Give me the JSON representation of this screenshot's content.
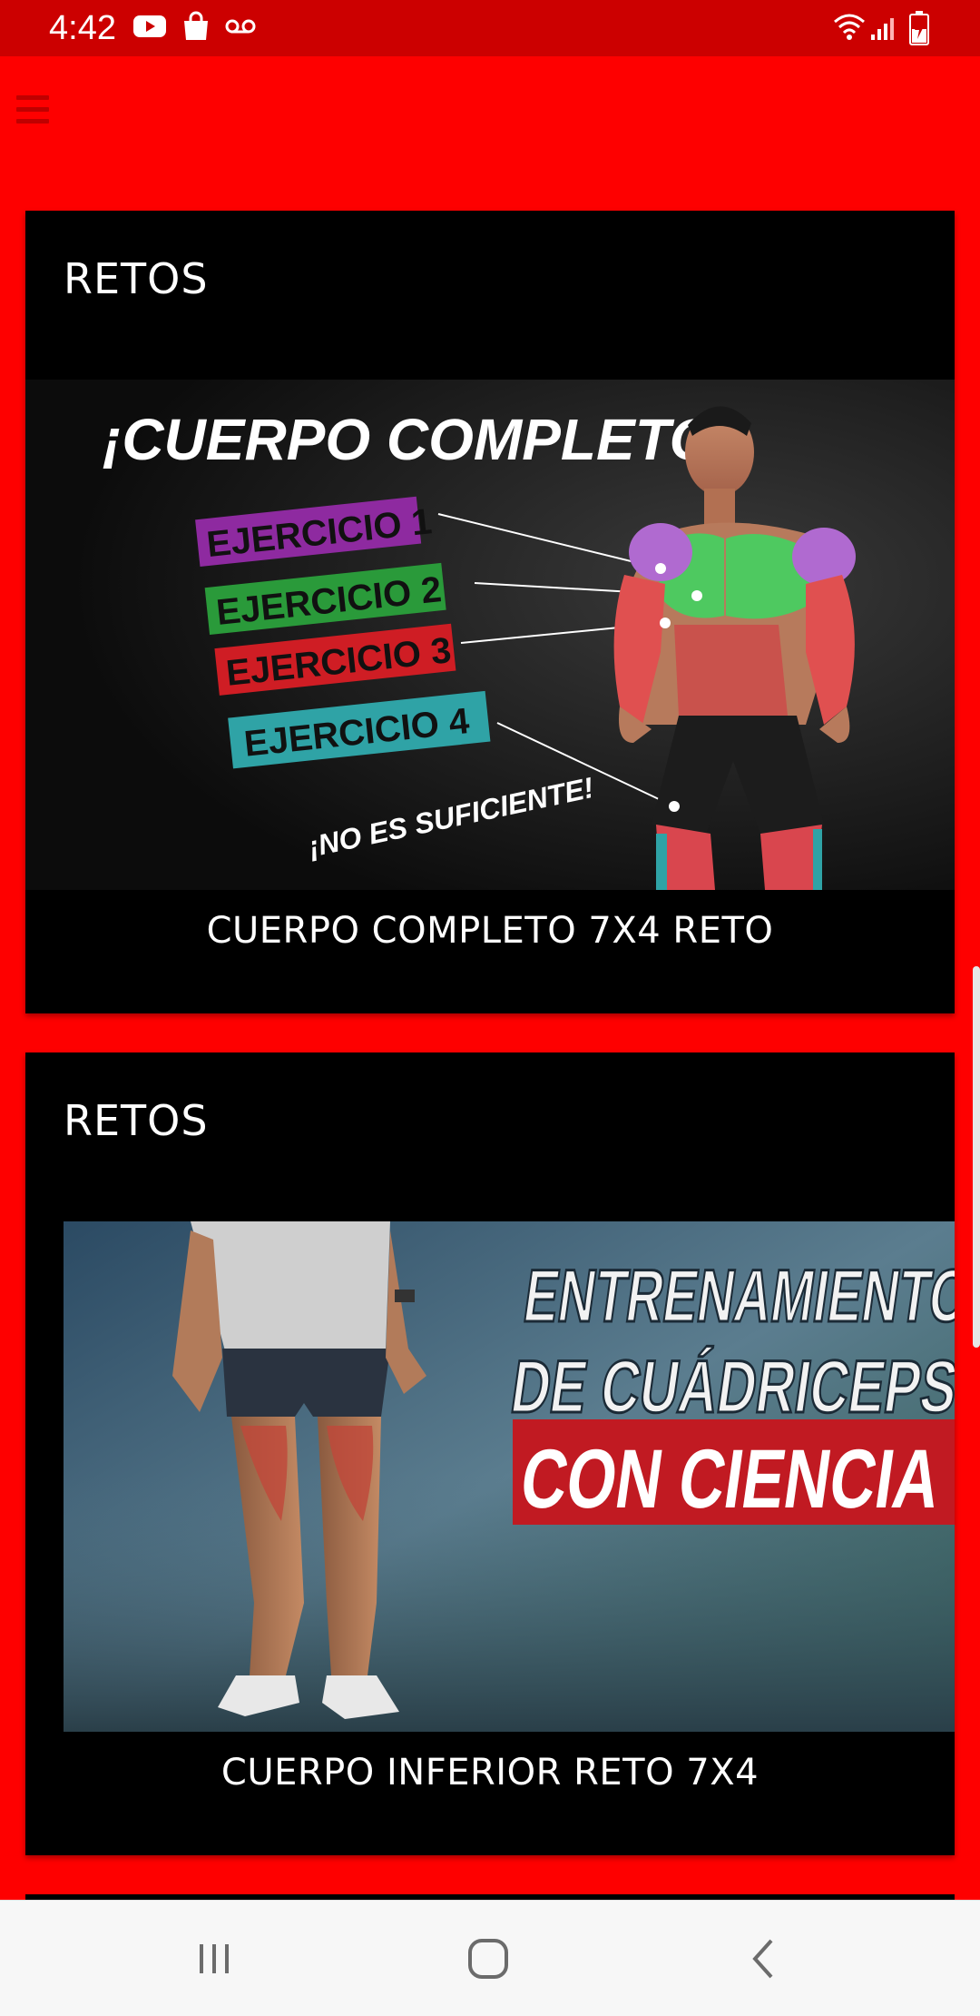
{
  "status_bar": {
    "time": "4:42",
    "left_icons": [
      "youtube-icon",
      "shopping-bag-icon",
      "voicemail-icon"
    ],
    "right_icons": [
      "wifi-icon",
      "signal-icon",
      "battery-charging-icon"
    ]
  },
  "app_bar": {
    "menu_icon": "menu-icon"
  },
  "cards": [
    {
      "heading": "RETOS",
      "title": "CUERPO COMPLETO 7X4 RETO",
      "image": {
        "headline": "¡CUERPO COMPLETO!",
        "labels": [
          "EJERCICIO 1",
          "EJERCICIO 2",
          "EJERCICIO 3",
          "EJERCICIO 4"
        ],
        "footer": "¡NO ES SUFICIENTE!"
      }
    },
    {
      "heading": "RETOS",
      "title": "CUERPO INFERIOR RETO 7X4",
      "image": {
        "line1": "ENTRENAMIENTO",
        "line2": "DE CUÁDRICEPS",
        "line3": "CON CIENCIA"
      }
    }
  ],
  "nav_bar": {
    "recents": "recents-icon",
    "home": "home-icon",
    "back": "back-icon"
  },
  "colors": {
    "background": "#fe0000",
    "status_bar": "#cc0000",
    "card": "#000000",
    "ejercicio1": "#8e2aa0",
    "ejercicio2": "#2a9a3a",
    "ejercicio3": "#cf1d24",
    "ejercicio4": "#2fa3a6"
  }
}
